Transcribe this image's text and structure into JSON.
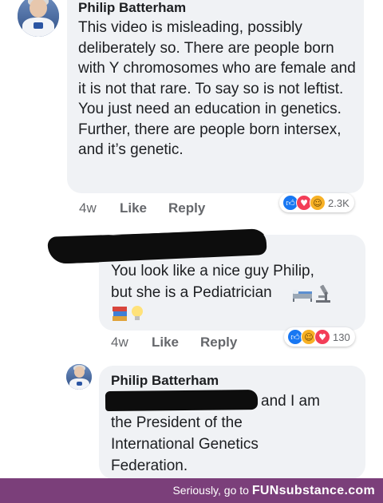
{
  "comments": [
    {
      "author": "Philip Batterham",
      "text": "This video is misleading, possibly deliberately so.  There are people born with Y chromosomes who are female and it is not that rare. To say so is not leftist.  You just need an education in genetics.  Further, there are people born intersex, and it’s genetic.",
      "time": "4w",
      "like_label": "Like",
      "reply_label": "Reply",
      "reaction_count": "2.3K",
      "reactions": [
        "like-icon",
        "love-icon",
        "haha-icon"
      ]
    },
    {
      "author": "",
      "text_line1": "You look like a nice guy Philip,",
      "text_line2": "but she is a Pediatrician",
      "time": "4w",
      "like_label": "Like",
      "reply_label": "Reply",
      "reaction_count": "130",
      "reactions": [
        "like-icon",
        "haha-icon",
        "love-icon"
      ],
      "emojis": [
        "bed-icon",
        "microscope-icon",
        "books-icon",
        "light-bulb-icon"
      ]
    },
    {
      "author": "Philip Batterham",
      "text_line1_tail": "and I am",
      "text_rest": "the President of the International Genetics Federation."
    }
  ],
  "footer": {
    "prefix": "Seriously, go to",
    "brand": "FUNsubstance.com"
  },
  "colors": {
    "bubble": "#f0f2f5",
    "footer": "#7b3f7a",
    "like": "#1877f2",
    "love": "#f33e58",
    "haha": "#f7b125"
  }
}
